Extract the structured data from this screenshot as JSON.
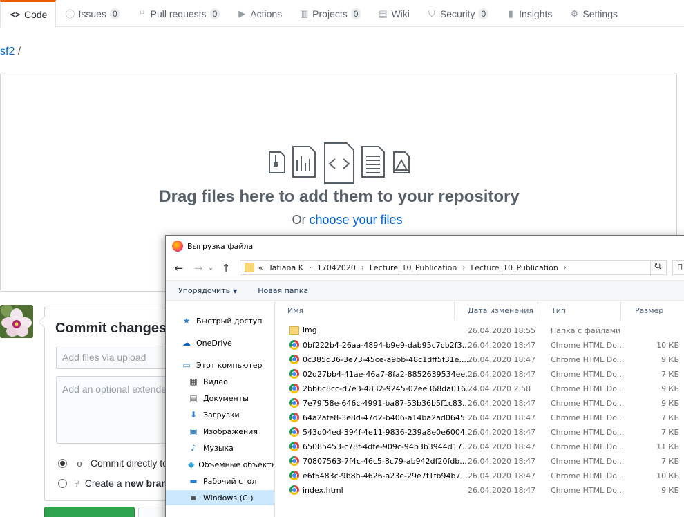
{
  "tabs": [
    {
      "label": "Code",
      "icon": "code-icon",
      "glyph": "<>"
    },
    {
      "label": "Issues",
      "icon": "issue-icon",
      "glyph": "ⓘ",
      "count": "0"
    },
    {
      "label": "Pull requests",
      "icon": "pull-request-icon",
      "glyph": "⑂",
      "count": "0"
    },
    {
      "label": "Actions",
      "icon": "play-icon",
      "glyph": "▶"
    },
    {
      "label": "Projects",
      "icon": "project-icon",
      "glyph": "▥",
      "count": "0"
    },
    {
      "label": "Wiki",
      "icon": "book-icon",
      "glyph": "▤"
    },
    {
      "label": "Security",
      "icon": "shield-icon",
      "glyph": "⛉",
      "count": "0"
    },
    {
      "label": "Insights",
      "icon": "graph-icon",
      "glyph": "▮"
    },
    {
      "label": "Settings",
      "icon": "gear-icon",
      "glyph": "⚙"
    }
  ],
  "breadcrumb": {
    "repo": "sf2",
    "sep": "/"
  },
  "dropzone": {
    "title": "Drag files here to add them to your repository",
    "sub_prefix": "Or",
    "choose_link": "choose your files"
  },
  "commit": {
    "title": "Commit changes",
    "summary_placeholder": "Add files via upload",
    "desc_placeholder": "Add an optional extended description…",
    "option_direct": "Commit directly to",
    "option_new_prefix": "Create a",
    "option_new_bold": "new bran"
  },
  "dialog": {
    "title": "Выгрузка файла",
    "path_prefix": "«",
    "path": [
      "Tatiana K",
      "17042020",
      "Lecture_10_Publication",
      "Lecture_10_Publication"
    ],
    "search_placeholder": "П",
    "toolbar": {
      "organize": "Упорядочить",
      "new_folder": "Новая папка"
    },
    "nav": [
      {
        "label": "Быстрый доступ",
        "icon": "star-icon",
        "glyph": "★",
        "color": "#2d7fd3"
      },
      {
        "label": "OneDrive",
        "icon": "cloud-icon",
        "glyph": "☁",
        "color": "#0a64c8"
      },
      {
        "label": "Этот компьютер",
        "icon": "computer-icon",
        "glyph": "▭",
        "color": "#3a88c8"
      },
      {
        "label": "Видео",
        "icon": "video-icon",
        "glyph": "▦",
        "color": "#333"
      },
      {
        "label": "Документы",
        "icon": "document-icon",
        "glyph": "▤",
        "color": "#666"
      },
      {
        "label": "Загрузки",
        "icon": "download-icon",
        "glyph": "⬇",
        "color": "#2d7fd3"
      },
      {
        "label": "Изображения",
        "icon": "pictures-icon",
        "glyph": "▣",
        "color": "#3a88c8"
      },
      {
        "label": "Музыка",
        "icon": "music-icon",
        "glyph": "♪",
        "color": "#2d7fd3"
      },
      {
        "label": "Объемные объекты",
        "icon": "3d-objects-icon",
        "glyph": "◆",
        "color": "#3aa6d8"
      },
      {
        "label": "Рабочий стол",
        "icon": "desktop-icon",
        "glyph": "▬",
        "color": "#2d7fd3"
      },
      {
        "label": "Windows (C:)",
        "icon": "drive-icon",
        "glyph": "▪",
        "color": "#555"
      }
    ],
    "columns": {
      "name": "Имя",
      "date": "Дата изменения",
      "type": "Тип",
      "size": "Размер"
    },
    "files": [
      {
        "name": "img",
        "date": "26.04.2020 18:55",
        "type": "Папка с файлами",
        "size": "",
        "kind": "folder"
      },
      {
        "name": "0bf222b4-26aa-4894-b9e9-dab95c7cb2f3....",
        "date": "26.04.2020 18:47",
        "type": "Chrome HTML Do...",
        "size": "10 КБ",
        "kind": "html"
      },
      {
        "name": "0c385d36-3e73-45ce-a9bb-48c1dff5f31e....",
        "date": "26.04.2020 18:47",
        "type": "Chrome HTML Do...",
        "size": "9 КБ",
        "kind": "html"
      },
      {
        "name": "02d27bb4-41ae-46a7-8fa2-8852639534ee....",
        "date": "26.04.2020 18:47",
        "type": "Chrome HTML Do...",
        "size": "7 КБ",
        "kind": "html"
      },
      {
        "name": "2bb6c8cc-d7e3-4832-9245-02ee368da016....",
        "date": "24.04.2020 2:58",
        "type": "Chrome HTML Do...",
        "size": "9 КБ",
        "kind": "html"
      },
      {
        "name": "7e79f58e-646c-4991-ba87-53b36b5f1c83....",
        "date": "26.04.2020 18:47",
        "type": "Chrome HTML Do...",
        "size": "9 КБ",
        "kind": "html"
      },
      {
        "name": "64a2afe8-3e8d-47d2-b406-a14ba2ad0645....",
        "date": "26.04.2020 18:47",
        "type": "Chrome HTML Do...",
        "size": "7 КБ",
        "kind": "html"
      },
      {
        "name": "543d04ed-394f-4e11-9836-239a8e0e6004....",
        "date": "26.04.2020 18:47",
        "type": "Chrome HTML Do...",
        "size": "7 КБ",
        "kind": "html"
      },
      {
        "name": "65085453-c78f-4dfe-909c-94b3b3944d17....",
        "date": "26.04.2020 18:47",
        "type": "Chrome HTML Do...",
        "size": "11 КБ",
        "kind": "html"
      },
      {
        "name": "70807563-7f4c-46c5-8c79-ab942df20fdb....",
        "date": "26.04.2020 18:47",
        "type": "Chrome HTML Do...",
        "size": "7 КБ",
        "kind": "html"
      },
      {
        "name": "e6f5483c-9b8b-4626-a23e-29e7f1fb94b7....",
        "date": "26.04.2020 18:47",
        "type": "Chrome HTML Do...",
        "size": "10 КБ",
        "kind": "html"
      },
      {
        "name": "index.html",
        "date": "26.04.2020 18:47",
        "type": "Chrome HTML Do...",
        "size": "9 КБ",
        "kind": "html"
      }
    ]
  }
}
